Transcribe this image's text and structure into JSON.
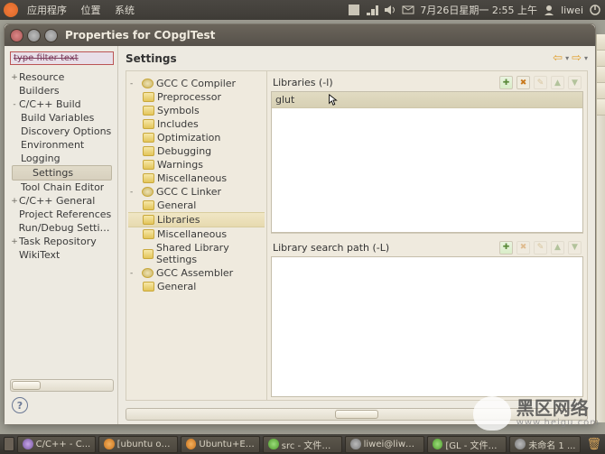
{
  "desktop": {
    "menus": [
      "应用程序",
      "位置",
      "系统"
    ],
    "datetime": "7月26日星期一  2:55 上午",
    "user": "liwei"
  },
  "window": {
    "title": "Properties for COpglTest"
  },
  "filter": {
    "placeholder": "type filter text"
  },
  "nav": {
    "items": [
      {
        "label": "Resource",
        "expander": "+"
      },
      {
        "label": "Builders",
        "expander": ""
      },
      {
        "label": "C/C++ Build",
        "expander": "-",
        "children": [
          {
            "label": "Build Variables"
          },
          {
            "label": "Discovery Options"
          },
          {
            "label": "Environment"
          },
          {
            "label": "Logging"
          },
          {
            "label": "Settings",
            "selected": true
          },
          {
            "label": "Tool Chain Editor"
          }
        ]
      },
      {
        "label": "C/C++ General",
        "expander": "+"
      },
      {
        "label": "Project References",
        "expander": ""
      },
      {
        "label": "Run/Debug Settings",
        "expander": ""
      },
      {
        "label": "Task Repository",
        "expander": "+"
      },
      {
        "label": "WikiText",
        "expander": ""
      }
    ]
  },
  "section_title": "Settings",
  "tree": [
    {
      "label": "GCC C Compiler",
      "expander": "-",
      "icon": "gear",
      "children": [
        {
          "label": "Preprocessor"
        },
        {
          "label": "Symbols"
        },
        {
          "label": "Includes"
        },
        {
          "label": "Optimization"
        },
        {
          "label": "Debugging"
        },
        {
          "label": "Warnings"
        },
        {
          "label": "Miscellaneous"
        }
      ]
    },
    {
      "label": "GCC C Linker",
      "expander": "-",
      "icon": "gear",
      "children": [
        {
          "label": "General"
        },
        {
          "label": "Libraries",
          "selected": true
        },
        {
          "label": "Miscellaneous"
        },
        {
          "label": "Shared Library Settings"
        }
      ]
    },
    {
      "label": "GCC Assembler",
      "expander": "-",
      "icon": "gear",
      "children": [
        {
          "label": "General"
        }
      ]
    }
  ],
  "panels": {
    "top": {
      "title": "Libraries (-l)",
      "items": [
        "glut"
      ]
    },
    "bottom": {
      "title": "Library search path (-L)",
      "items": []
    }
  },
  "taskbar": {
    "tasks": [
      {
        "label": "C/C++ - C...",
        "cls": "pur"
      },
      {
        "label": "[ubuntu op...",
        "cls": "ff"
      },
      {
        "label": "Ubuntu+Ec...",
        "cls": "ff"
      },
      {
        "label": "src - 文件浏...",
        "cls": "grn"
      },
      {
        "label": "liwei@liwei...",
        "cls": "gray"
      },
      {
        "label": "[GL - 文件浏...",
        "cls": "grn"
      },
      {
        "label": "未命名 1 ...",
        "cls": "gray"
      }
    ]
  },
  "watermark": {
    "title": "黑区网络",
    "sub": "www.heigu.com"
  },
  "help_char": "?"
}
